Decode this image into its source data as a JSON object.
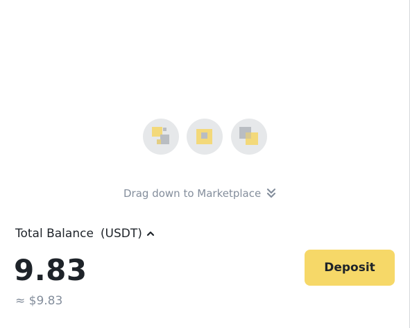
{
  "drag_hint": {
    "text": "Drag down to Marketplace",
    "icon": "double-chevron-down-icon"
  },
  "marketplace_icons": [
    "marketplace-icon-1",
    "marketplace-icon-2",
    "marketplace-icon-3"
  ],
  "balance": {
    "label": "Total Balance",
    "currency": "(USDT)",
    "caret_icon": "chevron-up-icon",
    "value": "9.83",
    "fiat_value": "≈ $9.83"
  },
  "actions": {
    "deposit_label": "Deposit"
  },
  "colors": {
    "accent": "#f6d868",
    "text_primary": "#1e2329",
    "text_secondary": "#848e9c"
  }
}
